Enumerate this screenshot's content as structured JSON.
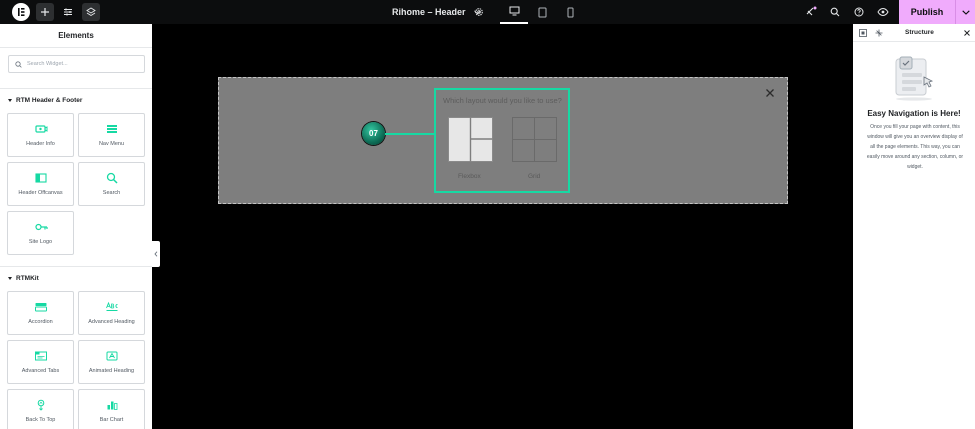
{
  "topbar": {
    "document_title": "Rihome – Header",
    "publish_label": "Publish"
  },
  "elements_panel": {
    "title": "Elements",
    "search_placeholder": "Search Widget...",
    "categories": [
      {
        "name": "RTM Header & Footer",
        "widgets": [
          {
            "label": "Header Info",
            "icon": "header-info-icon"
          },
          {
            "label": "Nav Menu",
            "icon": "nav-menu-icon"
          },
          {
            "label": "Header Offcanvas",
            "icon": "offcanvas-icon"
          },
          {
            "label": "Search",
            "icon": "search-icon"
          },
          {
            "label": "Site Logo",
            "icon": "site-logo-icon"
          }
        ]
      },
      {
        "name": "RTMKit",
        "widgets": [
          {
            "label": "Accordion",
            "icon": "accordion-icon"
          },
          {
            "label": "Advanced Heading",
            "icon": "advanced-heading-icon"
          },
          {
            "label": "Advanced Tabs",
            "icon": "tabs-icon"
          },
          {
            "label": "Animated Heading",
            "icon": "animated-heading-icon"
          },
          {
            "label": "Back To Top",
            "icon": "back-to-top-icon"
          },
          {
            "label": "Bar Chart",
            "icon": "bar-chart-icon"
          }
        ]
      }
    ]
  },
  "canvas": {
    "step_number": "07",
    "question": "Which layout would you like to use?",
    "options": [
      {
        "label": "Flexbox"
      },
      {
        "label": "Grid"
      }
    ]
  },
  "structure_panel": {
    "title": "Structure",
    "empty_title": "Easy Navigation is Here!",
    "empty_description": "Once you fill your page with content, this window will give you an overview display of all the page elements. This way, you can easily move around any section, column, or widget."
  },
  "colors": {
    "accent": "#16d9a3",
    "publish_bg": "#f0abfc",
    "topbar_bg": "#0c0d0e",
    "section_bg": "#7e7e7e"
  }
}
